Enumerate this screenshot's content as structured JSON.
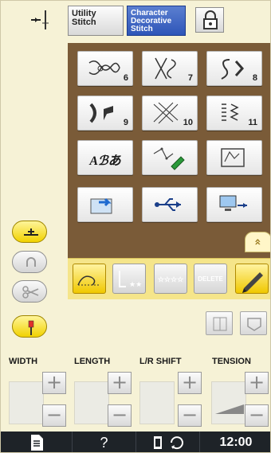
{
  "tabs": {
    "utility_label": "Utility\nStitch",
    "character_label": "Character\nDecorative\nStitch"
  },
  "patterns": [
    {
      "name": "pattern-6",
      "number": "6"
    },
    {
      "name": "pattern-7",
      "number": "7"
    },
    {
      "name": "pattern-8",
      "number": "8"
    },
    {
      "name": "pattern-9",
      "number": "9"
    },
    {
      "name": "pattern-10",
      "number": "10"
    },
    {
      "name": "pattern-11",
      "number": "11"
    }
  ],
  "char_button_text": "Aℬあ",
  "scroll_tab_glyph": "»",
  "ybar": {
    "delete_label": "DELETE",
    "stars_label": "☆☆☆☆"
  },
  "settings": {
    "width_label": "WIDTH",
    "length_label": "LENGTH",
    "lr_shift_label": "L/R SHIFT",
    "tension_label": "TENSION",
    "plus": "+",
    "minus": "−"
  },
  "status_bar": {
    "help_label": "?",
    "clock": "12:00"
  },
  "colors": {
    "panel": "#7a5b38",
    "yellow_bar": "#f5e58a",
    "selected_tab": "#2e55b8",
    "status_bar": "#1e2328"
  }
}
